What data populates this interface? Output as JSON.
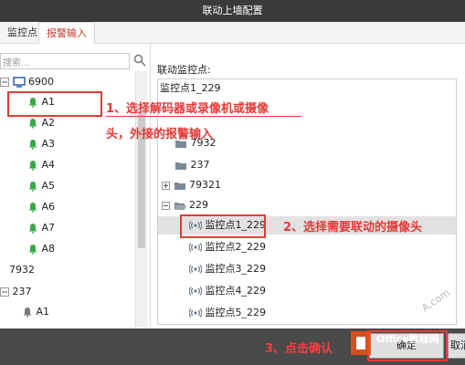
{
  "window": {
    "title": "联动上墙配置"
  },
  "tabs": [
    {
      "label": "监控点"
    },
    {
      "label": "报警输入"
    }
  ],
  "search": {
    "placeholder": "搜索..."
  },
  "left_tree": {
    "root1": {
      "label": "6900"
    },
    "alarms": [
      "A1",
      "A2",
      "A3",
      "A4",
      "A5",
      "A6",
      "A7",
      "A8"
    ],
    "node2": {
      "label": "7932"
    },
    "node3": {
      "label": "237"
    },
    "node3_child": {
      "label": "A1"
    }
  },
  "right": {
    "label": "联动监控点:",
    "rows": [
      {
        "label": "监控点1_229"
      },
      {
        "label": "7932"
      },
      {
        "label": "237"
      },
      {
        "label": "79321"
      },
      {
        "label": "229"
      },
      {
        "label": "监控点1_229"
      },
      {
        "label": "监控点2_229"
      },
      {
        "label": "监控点3_229"
      },
      {
        "label": "监控点4_229"
      },
      {
        "label": "监控点5_229"
      }
    ]
  },
  "annotations": {
    "step1a": "1、选择解码器或录像机或摄像",
    "step1b": "头，外接的报警输入",
    "step2": "2、选择需要联动的摄像头",
    "step3": "3、点击确认"
  },
  "buttons": {
    "ok": "确定",
    "cancel": "取消"
  },
  "watermark": {
    "site": "Office教程网",
    "url": "www.office26.com",
    "text": "Office教程网 www.office26.com"
  },
  "colors": {
    "accent": "#e53935",
    "title_bg": "#3a3a3a",
    "bottom_bg": "#4a4a4a"
  }
}
